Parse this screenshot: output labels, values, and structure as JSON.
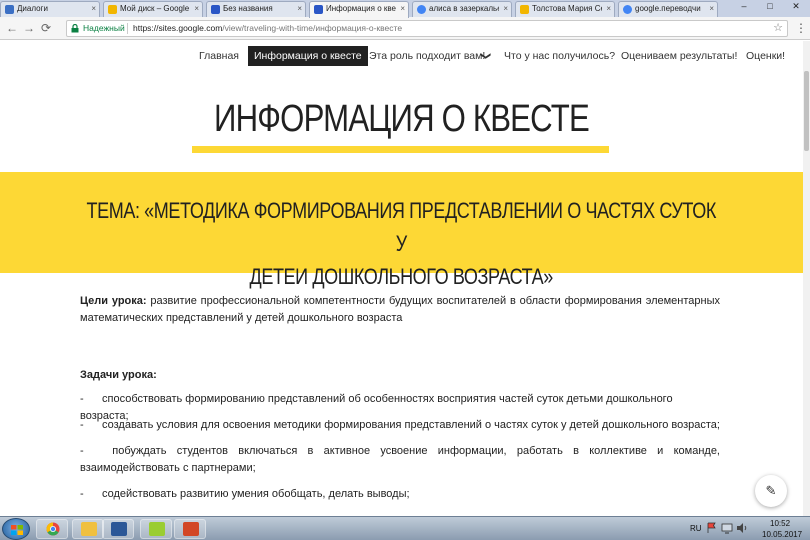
{
  "browser": {
    "tabs": [
      {
        "label": "Диалоги",
        "fav_color": "#3b6fc4"
      },
      {
        "label": "Мой диск – Google Д",
        "fav_color": "#f2b600"
      },
      {
        "label": "Без названия",
        "fav_color": "#2a56c6"
      },
      {
        "label": "Информация о квесте",
        "fav_color": "#2a56c6"
      },
      {
        "label": "алиса в зазеркалье",
        "fav_color": "#4285f4"
      },
      {
        "label": "Толстова Мария Сер",
        "fav_color": "#f2b600"
      },
      {
        "label": "google.переводчи",
        "fav_color": "#4285f4"
      }
    ],
    "window_controls": [
      "–",
      "□",
      "✕"
    ],
    "secure_label": "Надежный",
    "url_host": "https://sites.google.com",
    "url_path": "/view/traveling-with-time/информация-о-квесте",
    "nav_icons": [
      "back-icon",
      "forward-icon",
      "reload-icon"
    ],
    "nav_glyphs": [
      "←",
      "→",
      "⟳"
    ],
    "star_glyph": "☆",
    "menu_glyph": "⋮"
  },
  "site_nav": {
    "items": [
      {
        "label": "Главная",
        "active": false
      },
      {
        "label": "Информация о квесте",
        "active": true
      },
      {
        "label": "Эта роль подходит вам!",
        "active": false,
        "has_dropdown": true
      },
      {
        "label": "Что у нас получилось?",
        "active": false
      },
      {
        "label": "Оцениваем результаты!",
        "active": false
      },
      {
        "label": "Оценки!",
        "active": false
      }
    ],
    "dropdown_glyph": "❯"
  },
  "page": {
    "title": "ИНФОРМАЦИЯ О КВЕСТЕ",
    "theme_line1": "ТЕМА: «МЕТОДИКА ФОРМИРОВАНИЯ ПРЕДСТАВЛЕНИИ О ЧАСТЯХ СУТОК У",
    "theme_line2": "ДЕТЕИ ДОШКОЛЬНОГО ВОЗРАСТА»",
    "goals_label": "Цели урока:",
    "goals_text": " развитие профессиональной компетентности будущих воспитателей в области формирования элементарных математических представлений у детей дошкольного возраста",
    "tasks_label": "Задачи урока:",
    "task_dash": "-",
    "tasks": [
      "способствовать формированию представлений об особенностях восприятия частей суток детьми дошкольного возраста;",
      "создавать условия для освоения методики формирования представлений о частях суток у детей дошкольного возраста;",
      " побуждать студентов включаться в активное усвоение информации, работать в коллективе и команде, взаимодействовать с партнерами;",
      "содействовать развитию умения обобщать, делать выводы;"
    ],
    "edit_glyph": "✎"
  },
  "taskbar": {
    "apps": [
      {
        "name": "chrome",
        "color": "#e8453c"
      },
      {
        "name": "explorer",
        "color": "#f0c040"
      },
      {
        "name": "word",
        "color": "#2b5797"
      },
      {
        "name": "notes",
        "color": "#9acd32"
      },
      {
        "name": "presentation",
        "color": "#d24726"
      }
    ],
    "lang": "RU",
    "time": "10:52",
    "date": "10.05.2017"
  },
  "colors": {
    "accent_yellow": "#fdd835",
    "nav_active_bg": "#212121",
    "secure_green": "#0b8043"
  }
}
